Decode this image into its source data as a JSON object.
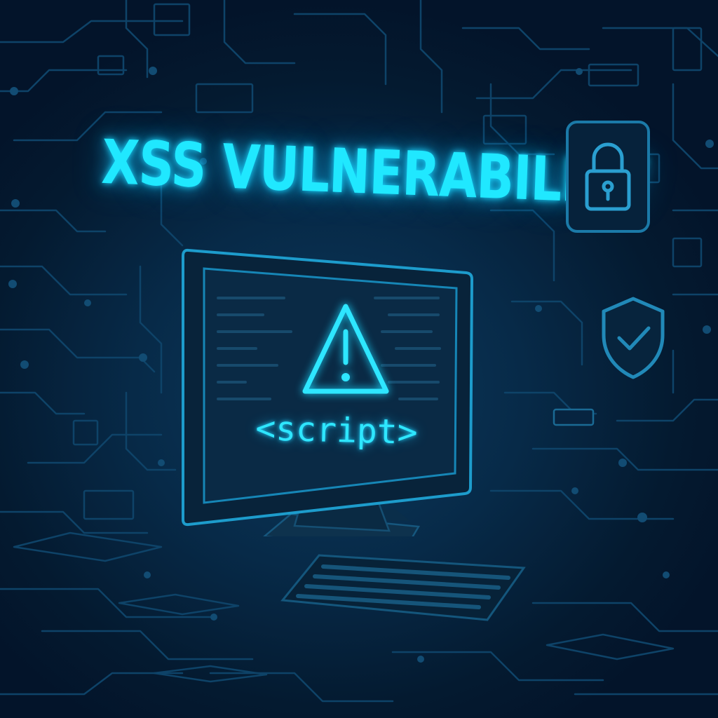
{
  "title": "XSS VULNERABILITY",
  "monitor": {
    "code_text": "<script>",
    "warning_icon": "warning-triangle-icon"
  },
  "side_icons": {
    "lock": "padlock-icon",
    "shield": "shield-check-icon"
  },
  "colors": {
    "background": "#04192c",
    "neon_accent": "#20e8ff",
    "circuit_line": "#0e4368",
    "panel": "#071e33"
  }
}
